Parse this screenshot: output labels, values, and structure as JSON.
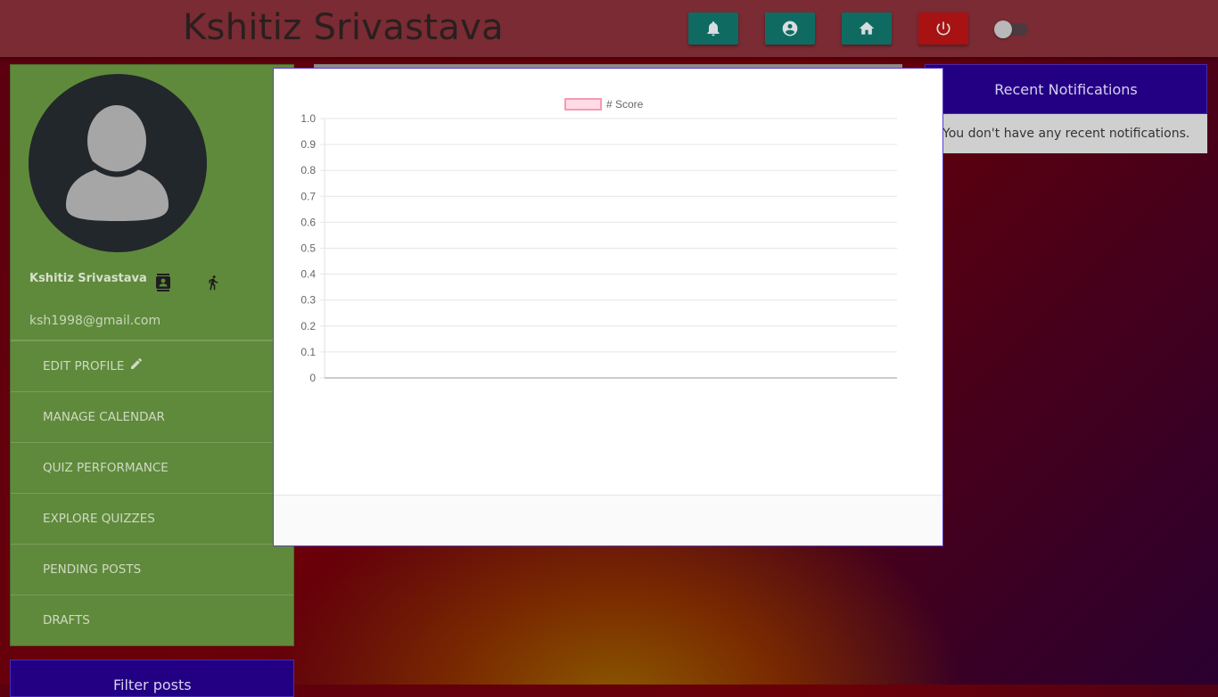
{
  "header": {
    "title": "Kshitiz Srivastava",
    "buttons": [
      {
        "icon": "bell-icon"
      },
      {
        "icon": "account-circle-icon"
      },
      {
        "icon": "home-icon"
      },
      {
        "icon": "power-icon"
      }
    ],
    "power_color": "#a81212",
    "button_color": "#0f6b61"
  },
  "sidebar": {
    "profile_name": "Kshitiz Srivastava",
    "email": "ksh1998@gmail.com",
    "menu": [
      {
        "label": "EDIT PROFILE"
      },
      {
        "label": "MANAGE CALENDAR"
      },
      {
        "label": "QUIZ PERFORMANCE"
      },
      {
        "label": "EXPLORE QUIZZES"
      },
      {
        "label": "PENDING POSTS"
      },
      {
        "label": "DRAFTS"
      }
    ],
    "filter_title": "Filter posts"
  },
  "notifications": {
    "title": "Recent Notifications",
    "empty_text": "You don't have any recent notifications."
  },
  "chart_data": {
    "type": "bar",
    "categories": [],
    "series": [
      {
        "name": "# Score",
        "values": []
      }
    ],
    "ylim": [
      0,
      1.0
    ],
    "yticks": [
      "0",
      "0.1",
      "0.2",
      "0.3",
      "0.4",
      "0.5",
      "0.6",
      "0.7",
      "0.8",
      "0.9",
      "1.0"
    ],
    "grid": true,
    "legend": "top-center",
    "series_color": "#f5a3b8"
  }
}
